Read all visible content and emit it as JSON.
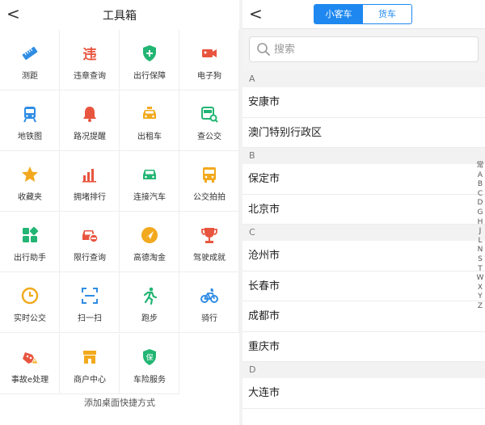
{
  "toolbox": {
    "back_glyph": "<",
    "title": "工具箱",
    "tools": [
      {
        "label": "测距",
        "icon": "ruler-icon",
        "color": "#2f8de4"
      },
      {
        "label": "违章查询",
        "icon": "violation-icon",
        "color": "#e8553f"
      },
      {
        "label": "出行保障",
        "icon": "shield-plus-icon",
        "color": "#22b573"
      },
      {
        "label": "电子狗",
        "icon": "camera-icon",
        "color": "#e8553f"
      },
      {
        "label": "地铁图",
        "icon": "subway-icon",
        "color": "#2f8de4"
      },
      {
        "label": "路况提醒",
        "icon": "bell-icon",
        "color": "#e8553f"
      },
      {
        "label": "出租车",
        "icon": "taxi-icon",
        "color": "#f2a91e"
      },
      {
        "label": "查公交",
        "icon": "bus-search-icon",
        "color": "#22b573"
      },
      {
        "label": "收藏夹",
        "icon": "star-icon",
        "color": "#f2a91e"
      },
      {
        "label": "拥堵排行",
        "icon": "bar-chart-icon",
        "color": "#e8553f"
      },
      {
        "label": "连接汽车",
        "icon": "car-icon",
        "color": "#22b573"
      },
      {
        "label": "公交拍拍",
        "icon": "bus-icon",
        "color": "#f2a91e"
      },
      {
        "label": "出行助手",
        "icon": "apps-icon",
        "color": "#22b573"
      },
      {
        "label": "限行查询",
        "icon": "car-restrict-icon",
        "color": "#e8553f"
      },
      {
        "label": "高德淘金",
        "icon": "compass-icon",
        "color": "#f2a91e"
      },
      {
        "label": "驾驶成就",
        "icon": "trophy-icon",
        "color": "#e8553f"
      },
      {
        "label": "实时公交",
        "icon": "clock-icon",
        "color": "#f2a91e"
      },
      {
        "label": "扫一扫",
        "icon": "scan-icon",
        "color": "#2f8de4"
      },
      {
        "label": "跑步",
        "icon": "runner-icon",
        "color": "#22b573"
      },
      {
        "label": "骑行",
        "icon": "bicycle-icon",
        "color": "#2f8de4"
      },
      {
        "label": "事故e处理",
        "icon": "accident-icon",
        "color": "#e8553f"
      },
      {
        "label": "商户中心",
        "icon": "store-icon",
        "color": "#f2a91e"
      },
      {
        "label": "车险服务",
        "icon": "insurance-icon",
        "color": "#22b573"
      }
    ],
    "footer": "添加桌面快捷方式"
  },
  "city_picker": {
    "back_glyph": "<",
    "tabs": [
      {
        "label": "小客车",
        "active": true
      },
      {
        "label": "货车",
        "active": false
      }
    ],
    "search": {
      "placeholder": "搜索",
      "value": ""
    },
    "sections": [
      {
        "letter": "A",
        "cities": [
          "安康市",
          "澳门特别行政区"
        ]
      },
      {
        "letter": "B",
        "cities": [
          "保定市",
          "北京市"
        ]
      },
      {
        "letter": "C",
        "cities": [
          "沧州市",
          "长春市",
          "成都市",
          "重庆市"
        ]
      },
      {
        "letter": "D",
        "cities": [
          "大连市"
        ]
      }
    ],
    "index_letters": [
      "常",
      "A",
      "B",
      "C",
      "D",
      "G",
      "H",
      "J",
      "L",
      "N",
      "S",
      "T",
      "W",
      "X",
      "Y",
      "Z"
    ]
  },
  "colors": {
    "accent": "#1e88f0",
    "red": "#e8553f",
    "green": "#22b573",
    "orange": "#f2a91e",
    "blue": "#2f8de4"
  }
}
